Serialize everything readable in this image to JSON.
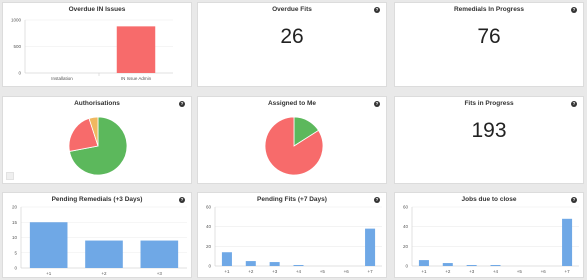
{
  "cards": {
    "overdue_in": {
      "title": "Overdue IN Issues",
      "chart_data": {
        "type": "bar",
        "categories": [
          "Installation",
          "IN Issue Admin"
        ],
        "values": [
          0,
          880
        ],
        "ylim": [
          0,
          1000
        ],
        "yticks": [
          "0",
          "500",
          "1000"
        ],
        "color": "#f76b6b"
      }
    },
    "overdue_fits": {
      "title": "Overdue Fits",
      "value": "26",
      "help": "?"
    },
    "remedials_in_progress": {
      "title": "Remedials In Progress",
      "value": "76",
      "help": "?"
    },
    "authorisations": {
      "title": "Authorisations",
      "help": "?",
      "chart_data": {
        "type": "pie",
        "slices": [
          {
            "value": 72,
            "color": "#5cb85c"
          },
          {
            "value": 23,
            "color": "#f76b6b"
          },
          {
            "value": 5,
            "color": "#f0b860"
          }
        ]
      }
    },
    "assigned_to_me": {
      "title": "Assigned to Me",
      "help": "?",
      "chart_data": {
        "type": "pie",
        "slices": [
          {
            "value": 16,
            "color": "#5cb85c"
          },
          {
            "value": 84,
            "color": "#f76b6b"
          }
        ]
      }
    },
    "fits_in_progress": {
      "title": "Fits in Progress",
      "value": "193",
      "help": "?"
    },
    "pending_remedials": {
      "title": "Pending Remedials (+3 Days)",
      "help": "?",
      "chart_data": {
        "type": "bar",
        "categories": [
          "+1",
          "+2",
          "+3"
        ],
        "values": [
          15,
          9,
          9
        ],
        "ylim": [
          0,
          20
        ],
        "yticks": [
          "0",
          "5",
          "10",
          "15",
          "20"
        ],
        "color": "#6fa8e6"
      }
    },
    "pending_fits": {
      "title": "Pending Fits (+7 Days)",
      "help": "?",
      "chart_data": {
        "type": "bar",
        "categories": [
          "+1",
          "+2",
          "+3",
          "+4",
          "+5",
          "+6",
          "+7"
        ],
        "values": [
          14,
          5,
          4,
          1,
          0,
          0,
          38
        ],
        "ylim": [
          0,
          60
        ],
        "yticks": [
          "0",
          "20",
          "40",
          "60"
        ],
        "color": "#6fa8e6"
      }
    },
    "jobs_due": {
      "title": "Jobs due to close",
      "help": "?",
      "chart_data": {
        "type": "bar",
        "categories": [
          "+1",
          "+2",
          "+3",
          "+4",
          "+5",
          "+6",
          "+7"
        ],
        "values": [
          6,
          3,
          1,
          1,
          0,
          0,
          48
        ],
        "ylim": [
          0,
          60
        ],
        "yticks": [
          "0",
          "20",
          "40",
          "60"
        ],
        "color": "#6fa8e6"
      }
    }
  }
}
